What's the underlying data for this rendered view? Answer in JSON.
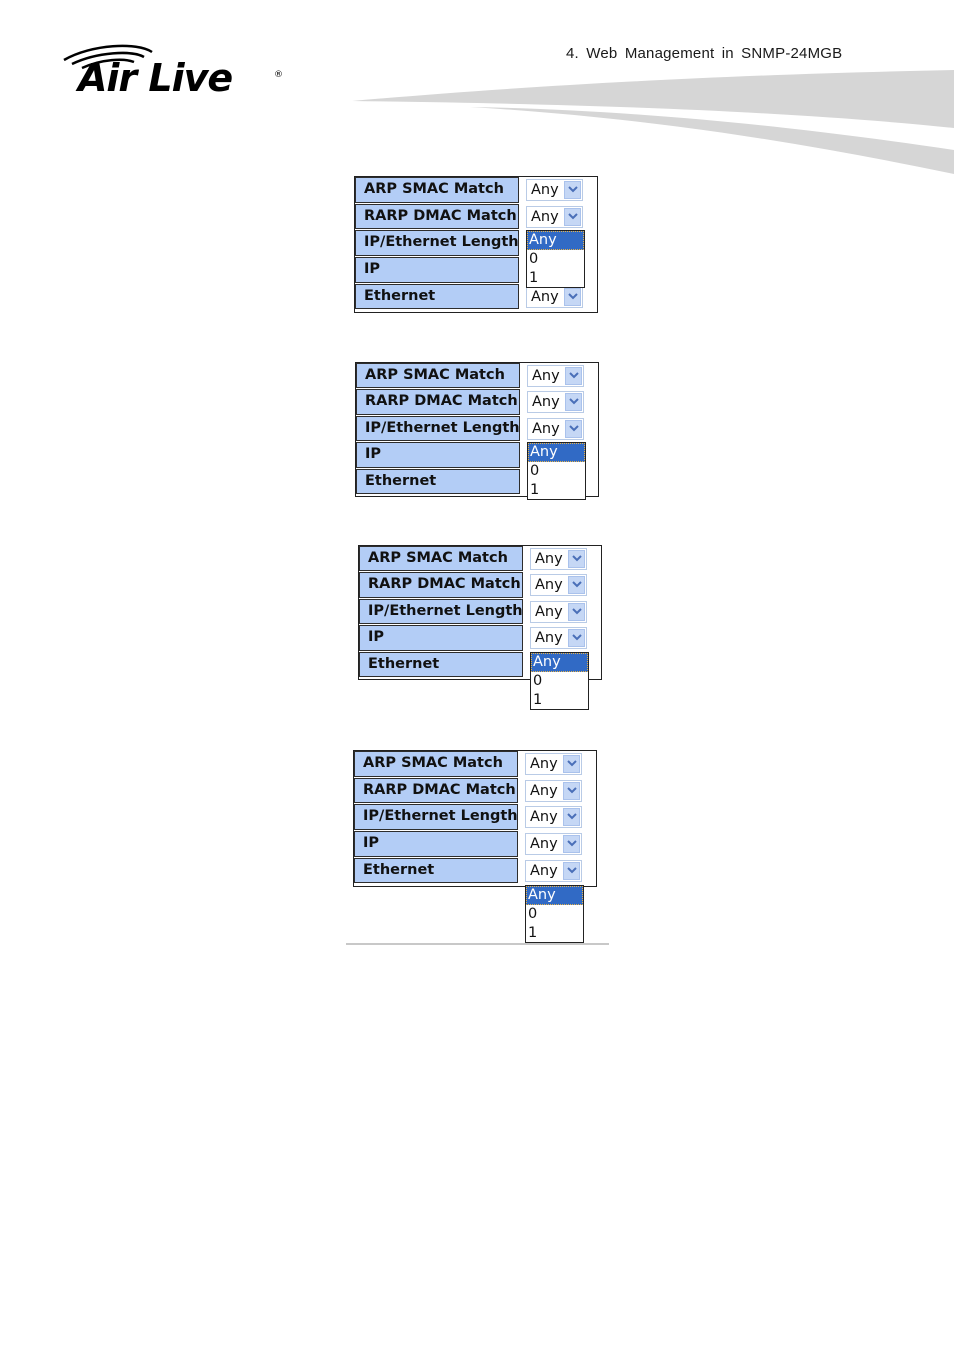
{
  "header": {
    "title": "4.   Web Management in SNMP-24MGB",
    "logo_text": "Air Live",
    "logo_registered": "®"
  },
  "colors": {
    "label_bg": "#b3cdf6",
    "selected_option_bg": "#316ac5",
    "dropdown_button_bg": "#c5d7f5"
  },
  "panels": [
    {
      "open_field": "IP/Ethernet Length",
      "rows": [
        {
          "label": "ARP SMAC Match",
          "value": "Any"
        },
        {
          "label": "RARP DMAC Match",
          "value": "Any"
        },
        {
          "label": "IP/Ethernet Length",
          "value": "Any"
        },
        {
          "label": "IP",
          "value": "Any"
        },
        {
          "label": "Ethernet",
          "value": "Any"
        }
      ],
      "options": [
        "Any",
        "0",
        "1"
      ],
      "selected_option": "Any"
    },
    {
      "open_field": "IP",
      "rows": [
        {
          "label": "ARP SMAC Match",
          "value": "Any"
        },
        {
          "label": "RARP DMAC Match",
          "value": "Any"
        },
        {
          "label": "IP/Ethernet Length",
          "value": "Any"
        },
        {
          "label": "IP",
          "value": "Any"
        },
        {
          "label": "Ethernet",
          "value": "Any"
        }
      ],
      "options": [
        "Any",
        "0",
        "1"
      ],
      "selected_option": "Any"
    },
    {
      "open_field": "Ethernet",
      "rows": [
        {
          "label": "ARP SMAC Match",
          "value": "Any"
        },
        {
          "label": "RARP DMAC Match",
          "value": "Any"
        },
        {
          "label": "IP/Ethernet Length",
          "value": "Any"
        },
        {
          "label": "IP",
          "value": "Any"
        },
        {
          "label": "Ethernet",
          "value": "Any"
        }
      ],
      "options": [
        "Any",
        "0",
        "1"
      ],
      "selected_option": "Any"
    },
    {
      "open_field": "Ethernet",
      "rows": [
        {
          "label": "ARP SMAC Match",
          "value": "Any"
        },
        {
          "label": "RARP DMAC Match",
          "value": "Any"
        },
        {
          "label": "IP/Ethernet Length",
          "value": "Any"
        },
        {
          "label": "IP",
          "value": "Any"
        },
        {
          "label": "Ethernet",
          "value": "Any"
        }
      ],
      "options": [
        "Any",
        "0",
        "1"
      ],
      "selected_option": "Any"
    }
  ]
}
